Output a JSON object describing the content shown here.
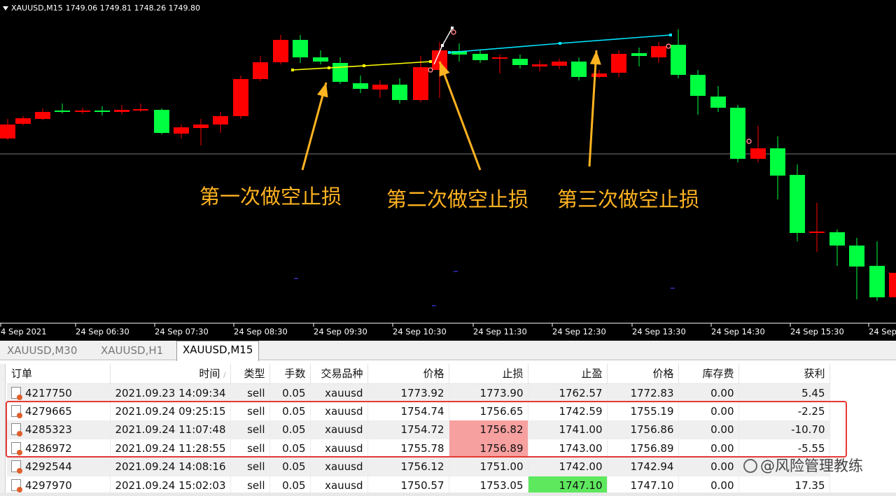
{
  "chart": {
    "symbol": "XAUUSD,M15",
    "ohlc": "1749.06 1749.81 1748.26 1749.80",
    "xticks": [
      "4 Sep 2021",
      "24 Sep 06:30",
      "24 Sep 07:30",
      "24 Sep 08:30",
      "24 Sep 09:30",
      "24 Sep 10:30",
      "24 Sep 11:30",
      "24 Sep 12:30",
      "24 Sep 13:30",
      "24 Sep 14:30",
      "24 Sep 15:30",
      "24 Sep"
    ],
    "annotations": [
      "第一次做空止损",
      "第二次做空止损",
      "第三次做空止损"
    ],
    "colors": {
      "background": "#000000",
      "bull": "#00ff40",
      "bear": "#ff0000",
      "annotation": "#ffb321",
      "line1": "#ffff00",
      "line2": "#00e5ff"
    }
  },
  "tabs": [
    "XAUUSD,M30",
    "XAUUSD,H1",
    "XAUUSD,M15"
  ],
  "active_tab": "XAUUSD,M15",
  "table": {
    "headers": [
      "订单",
      "时间",
      "类型",
      "手数",
      "交易品种",
      "价格",
      "止损",
      "止盈",
      "价格",
      "库存费",
      "获利"
    ],
    "sort_indicator": "/",
    "rows": [
      [
        "4217750",
        "2021.09.23 14:09:34",
        "sell",
        "0.05",
        "xauusd",
        "1773.92",
        "1773.90",
        "1762.57",
        "1772.83",
        "0.00",
        "5.45"
      ],
      [
        "4279665",
        "2021.09.24 09:25:15",
        "sell",
        "0.05",
        "xauusd",
        "1754.74",
        "1756.65",
        "1742.59",
        "1755.19",
        "0.00",
        "-2.25"
      ],
      [
        "4285323",
        "2021.09.24 11:07:48",
        "sell",
        "0.05",
        "xauusd",
        "1754.72",
        "1756.82",
        "1741.00",
        "1756.86",
        "0.00",
        "-10.70"
      ],
      [
        "4286972",
        "2021.09.24 11:28:55",
        "sell",
        "0.05",
        "xauusd",
        "1755.78",
        "1756.89",
        "1743.00",
        "1756.89",
        "0.00",
        "-5.55"
      ],
      [
        "4292544",
        "2021.09.24 14:08:16",
        "sell",
        "0.05",
        "xauusd",
        "1756.12",
        "1751.00",
        "1742.00",
        "1742.94",
        "0.00",
        ""
      ],
      [
        "4297970",
        "2021.09.24 15:02:03",
        "sell",
        "0.05",
        "xauusd",
        "1750.57",
        "1753.05",
        "1747.10",
        "1747.10",
        "0.00",
        "17.35"
      ]
    ]
  },
  "watermark": "风险管理教练"
}
